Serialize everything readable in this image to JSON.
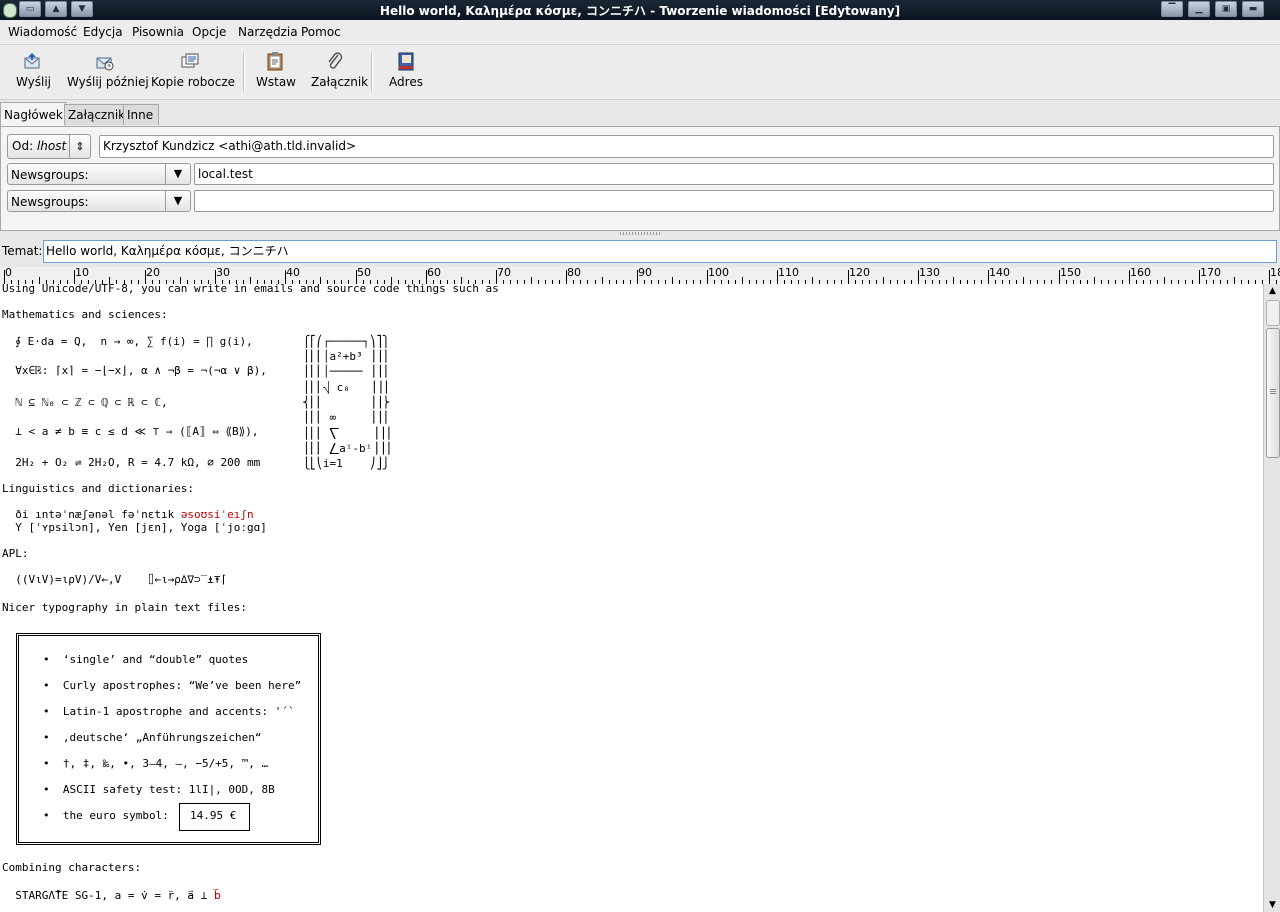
{
  "window": {
    "title": "Hello world, Καλημέρα κόσμε, コンニチハ - Tworzenie wiadomości  [Edytowany]"
  },
  "menubar": [
    "Wiadomość",
    "Edycja",
    "Pisownia",
    "Opcje",
    "Narzędzia",
    "Pomoc"
  ],
  "toolbar": {
    "send": "Wyślij",
    "send_later": "Wyślij później",
    "drafts": "Kopie robocze",
    "insert": "Wstaw",
    "attachment": "Załącznik",
    "address": "Adres"
  },
  "tabs": [
    "Nagłówek",
    "Załączniki",
    "Inne"
  ],
  "header": {
    "from_label": "Od:",
    "from_identity": "lhost",
    "from_value": "Krzysztof Kundzicz <athi@ath.tld.invalid>",
    "rows": [
      {
        "type": "Newsgroups:",
        "value": "local.test"
      },
      {
        "type": "Newsgroups:",
        "value": ""
      }
    ]
  },
  "subject": {
    "label": "Temat:",
    "value": "Hello world, Καλημέρα κόσμε, コンニチハ"
  },
  "ruler": {
    "labels": [
      "0",
      "10",
      "20",
      "30",
      "40",
      "50",
      "60",
      "70",
      "80",
      "90",
      "100",
      "110",
      "120",
      "130",
      "140",
      "150",
      "160",
      "170",
      "18"
    ]
  },
  "body": {
    "intro": "Using Unicode/UTF-8, you can write in emails and source code things such as",
    "math_heading": "Mathematics and sciences:",
    "math": [
      "  ∮ E⋅da = Q,  n → ∞, ∑ f(i) = ∏ g(i),",
      "  ∀x∈ℝ: ⌈x⌉ = −⌊−x⌋, α ∧ ¬β = ¬(¬α ∨ β),",
      "  ℕ ⊆ ℕ₀ ⊂ ℤ ⊂ ℚ ⊂ ℝ ⊂ ℂ,",
      "  ⊥ < a ≠ b ≡ c ≤ d ≪ ⊤ ⇒ (⟦A⟧ ⇔ ⟪B⟫),",
      "  2H₂ + O₂ ⇌ 2H₂O, R = 4.7 kΩ, ⌀ 200 mm"
    ],
    "formula": [
      "⎧⎡⎛┌─────┐⎞⎤⎫",
      "⎪⎢⎜│a²+b³ ⎟⎥⎪",
      "⎪⎢⎜│───── ⎟⎥⎪",
      "⎪⎢⎜⎷ c₈   ⎟⎥⎪",
      "⎨⎢⎜       ⎟⎥⎬",
      "⎪⎢⎜ ∞     ⎟⎥⎪",
      "⎪⎢⎜ ⎲     ⎟⎥⎪",
      "⎪⎢⎜ ⎳aⁱ-bⁱ⎟⎥⎪",
      "⎩⎣⎝i=1    ⎠⎦⎭"
    ],
    "ling_heading": "Linguistics and dictionaries:",
    "ling1_pre": "  ði ıntəˈnæʃənəl fəˈnɛtık ",
    "ling1_red": "əsoʊsiˈeıʃn",
    "ling2": "  Y [ˈʏpsilɔn], Yen [jɛn], Yoga [ˈjoːgɑ]",
    "apl_heading": "APL:",
    "apl": "  ((V⍳V)=⍳⍴V)/V←,V    ⌷←⍳→⍴∆∇⊃‾⍎⍕⌈",
    "typo_heading": "Nicer typography in plain text files:",
    "bullets": [
      "•  ‘single’ and “double” quotes",
      "•  Curly apostrophes: “We’ve been here”",
      "•  Latin-1 apostrophe and accents: '´`",
      "•  ‚deutsche‘ „Anführungszeichen“",
      "•  †, ‡, ‰, •, 3–4, —, −5/+5, ™, …",
      "•  ASCII safety test: 1lI|, 0OD, 8B"
    ],
    "euro_prefix": "•  the euro symbol:",
    "euro_value": "14.95 €",
    "comb_heading": "Combining characters:",
    "comb_pre": "  STARGΛ̊TE SG-1, a = v̇ = r̈, a⃑ ⊥ ",
    "comb_red": "b⃑"
  }
}
